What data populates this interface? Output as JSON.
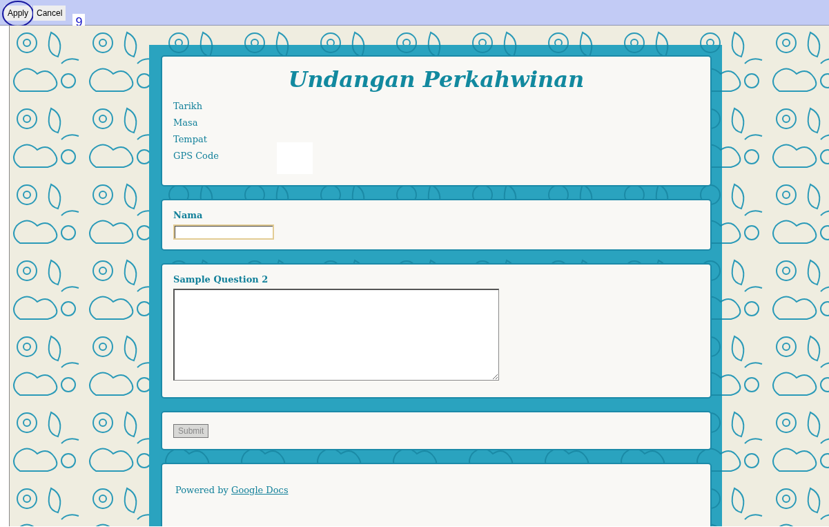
{
  "toolbar": {
    "buttons": [
      {
        "label": "Apply",
        "circled": true
      },
      {
        "label": "Cancel",
        "circled": false
      }
    ],
    "badge": "9"
  },
  "form": {
    "title": "Undangan Perkahwinan",
    "details": [
      "Tarikh",
      "Masa",
      "Tempat",
      "GPS Code"
    ],
    "questions": [
      {
        "kind": "text",
        "label": "Nama",
        "focused": true
      },
      {
        "kind": "paragraph",
        "label": "Sample Question 2",
        "focused": false
      }
    ],
    "submit": {
      "label": "Submit",
      "disabled": true
    },
    "footer": {
      "prefix": "Powered by",
      "link": "Google Docs"
    }
  }
}
